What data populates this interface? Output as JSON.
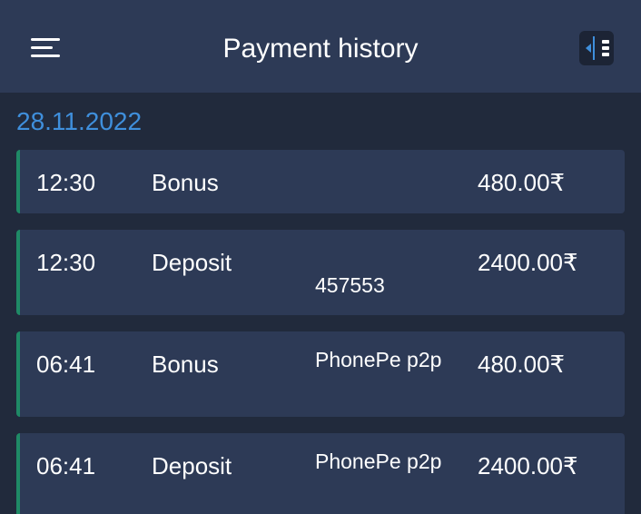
{
  "header": {
    "title": "Payment history"
  },
  "date": "28.11.2022",
  "transactions": [
    {
      "time": "12:30",
      "type": "Bonus",
      "method": "",
      "amount": "480.00₹"
    },
    {
      "time": "12:30",
      "type": "Deposit",
      "method": "457553",
      "amount": "2400.00₹"
    },
    {
      "time": "06:41",
      "type": "Bonus",
      "method": "PhonePe p2p",
      "amount": "480.00₹"
    },
    {
      "time": "06:41",
      "type": "Deposit",
      "method": "PhonePe p2p",
      "amount": "2400.00₹"
    }
  ],
  "colors": {
    "background": "#212a3c",
    "header": "#2d3a56",
    "row": "#2d3a56",
    "accent_date": "#3f8fdc",
    "row_border": "#1f8a66",
    "panel_icon": "#3f8fdc"
  },
  "icons": {
    "menu": "hamburger-menu-icon",
    "panel": "collapse-panel-icon"
  }
}
